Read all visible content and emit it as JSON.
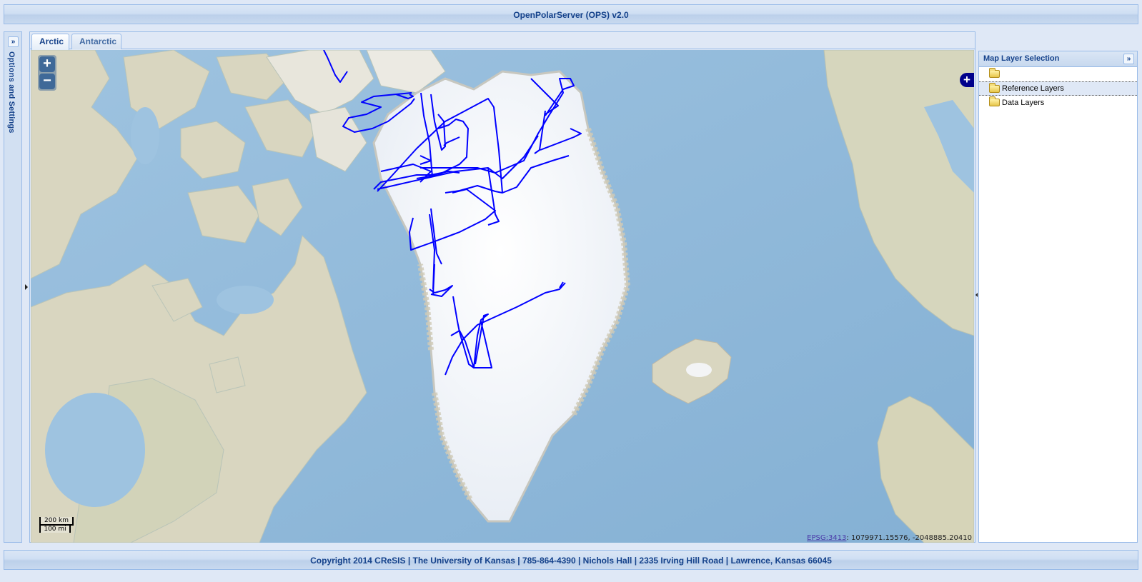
{
  "header": {
    "title": "OpenPolarServer (OPS) v2.0"
  },
  "west_panel": {
    "title": "Options and Settings",
    "expand_icon": "double-chevron-right"
  },
  "tabs": [
    {
      "label": "Arctic",
      "active": true
    },
    {
      "label": "Antarctic",
      "active": false
    }
  ],
  "map": {
    "zoom_in": "+",
    "zoom_out": "−",
    "scale": {
      "metric": "200 km",
      "imperial": "100 mi"
    },
    "projection_link": "EPSG:3413",
    "coordinates": ": 1079971.15576, -2048885.20410",
    "layer_switcher": "+",
    "flight_line_color": "#0000ff",
    "colors": {
      "ocean": "#8fb8d9",
      "land": "#dcd9c3",
      "ice": "#f3f6fa"
    }
  },
  "layer_panel": {
    "title": "Map Layer Selection",
    "collapse_icon": "double-chevron-right",
    "nodes": [
      {
        "label": "",
        "icon": "folder-icon",
        "selected": false
      },
      {
        "label": "Reference Layers",
        "icon": "folder-icon",
        "selected": true
      },
      {
        "label": "Data Layers",
        "icon": "folder-icon",
        "selected": false
      }
    ]
  },
  "footer": {
    "text": "Copyright 2014 CReSIS | The University of Kansas | 785-864-4390 | Nichols Hall | 2335 Irving Hill Road | Lawrence, Kansas 66045"
  },
  "theme": {
    "accent": "#15428b",
    "border": "#99bbe8",
    "panel_bg": "#dfe8f6"
  }
}
